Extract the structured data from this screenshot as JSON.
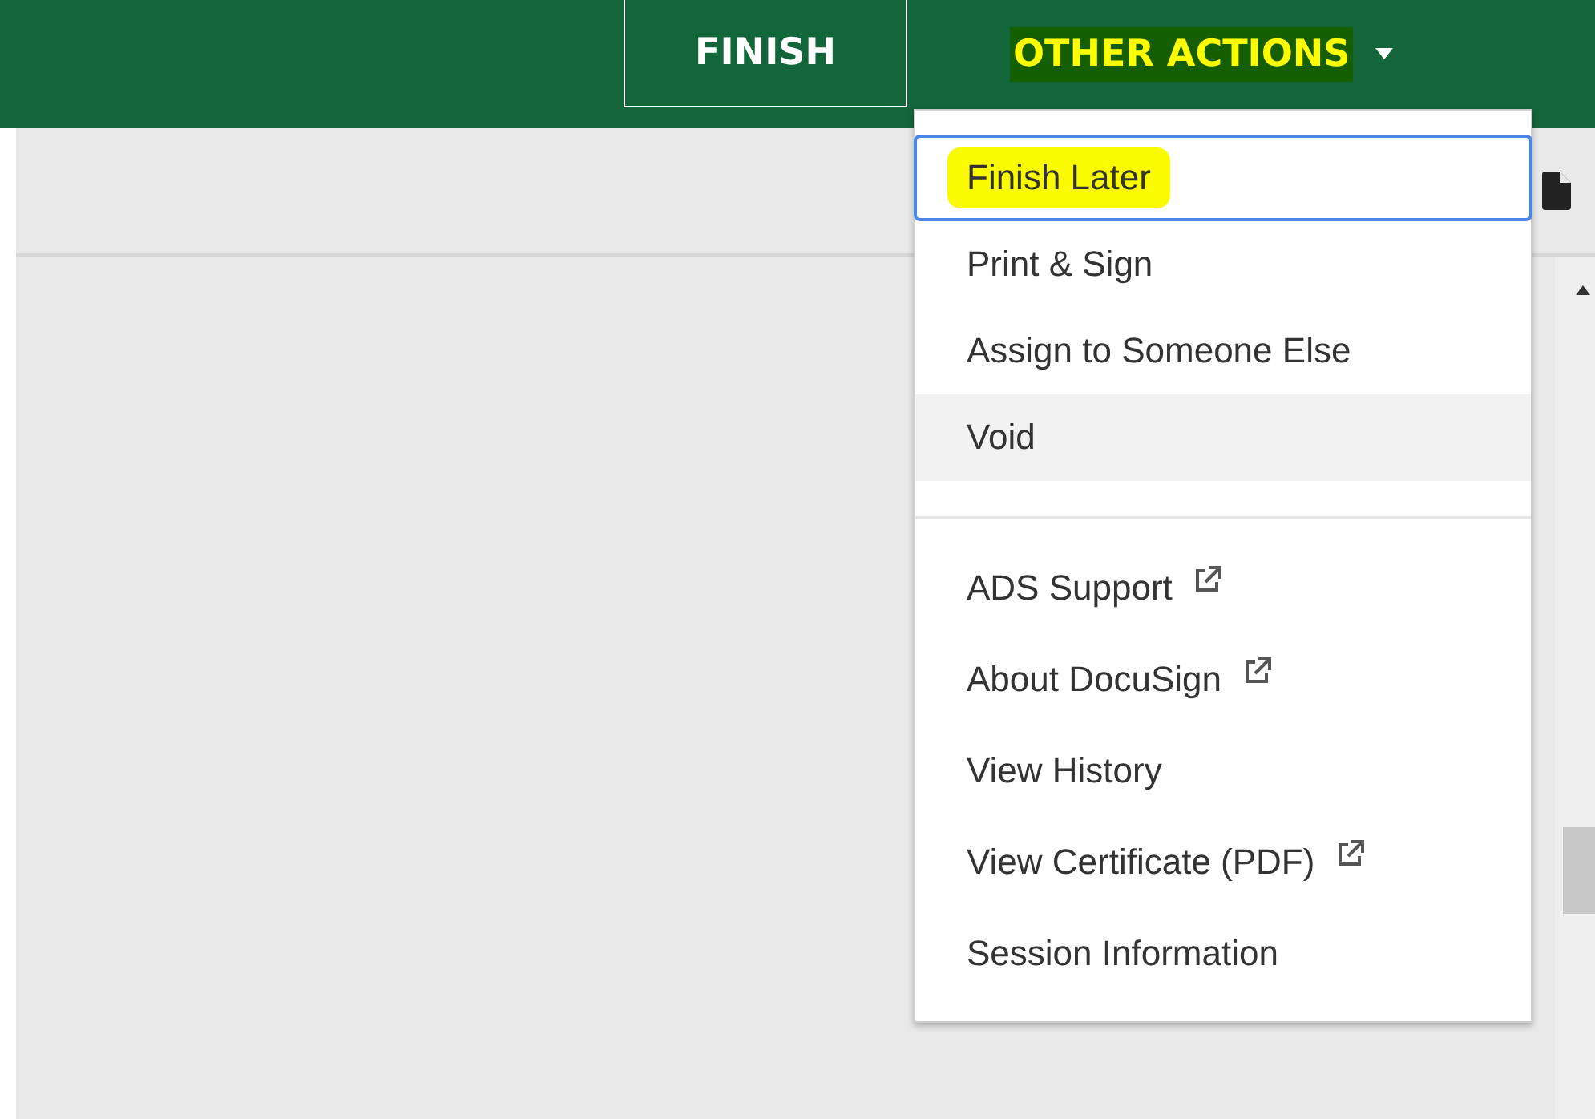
{
  "header": {
    "buttons": [
      {
        "label": "FINISH",
        "kind": "outlined",
        "highlighted": false
      },
      {
        "label": "OTHER ACTIONS",
        "kind": "dropdown",
        "highlighted": true
      }
    ]
  },
  "menu": {
    "groups": [
      {
        "items": [
          {
            "label": "Finish Later",
            "focused": true,
            "hovered": false,
            "highlighted": true,
            "external": false
          },
          {
            "label": "Print & Sign",
            "focused": false,
            "hovered": false,
            "highlighted": false,
            "external": false
          },
          {
            "label": "Assign to Someone Else",
            "focused": false,
            "hovered": false,
            "highlighted": false,
            "external": false
          },
          {
            "label": "Void",
            "focused": false,
            "hovered": true,
            "highlighted": false,
            "external": false
          }
        ]
      },
      {
        "items": [
          {
            "label": "ADS Support",
            "focused": false,
            "hovered": false,
            "highlighted": false,
            "external": true
          },
          {
            "label": "About DocuSign",
            "focused": false,
            "hovered": false,
            "highlighted": false,
            "external": true
          },
          {
            "label": "View History",
            "focused": false,
            "hovered": false,
            "highlighted": false,
            "external": false
          },
          {
            "label": "View Certificate (PDF)",
            "focused": false,
            "hovered": false,
            "highlighted": false,
            "external": true
          },
          {
            "label": "Session Information",
            "focused": false,
            "hovered": false,
            "highlighted": false,
            "external": false
          }
        ]
      }
    ]
  }
}
